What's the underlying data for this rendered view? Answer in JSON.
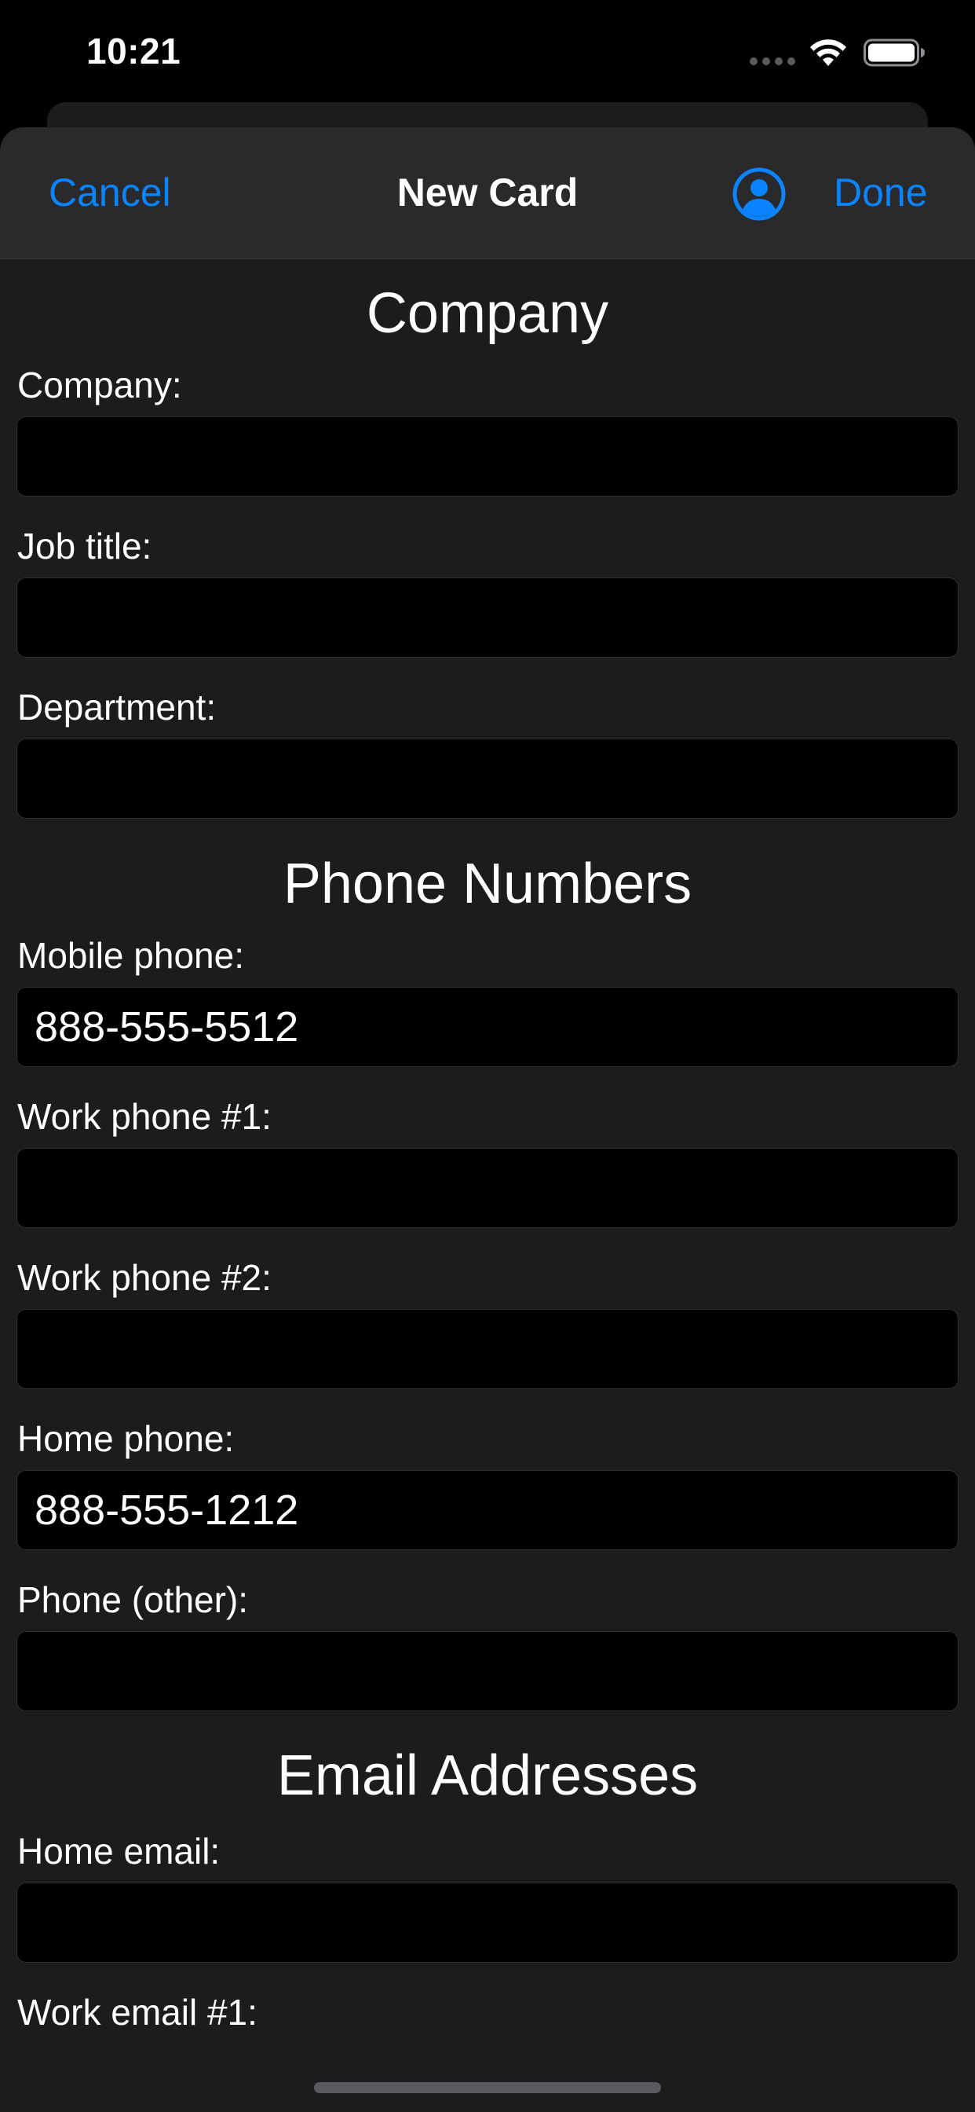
{
  "status_bar": {
    "time": "10:21"
  },
  "nav": {
    "cancel_label": "Cancel",
    "title": "New Card",
    "done_label": "Done",
    "person_icon": "person-circle-icon"
  },
  "colors": {
    "accent": "#0a84ff",
    "sheet_bg": "#1c1c1e",
    "nav_bg": "#2a2a2c",
    "input_bg": "#000000"
  },
  "sections": {
    "company": {
      "title": "Company",
      "fields": [
        {
          "label": "Company:",
          "value": ""
        },
        {
          "label": "Job title:",
          "value": ""
        },
        {
          "label": "Department:",
          "value": ""
        }
      ]
    },
    "phone": {
      "title": "Phone Numbers",
      "fields": [
        {
          "label": "Mobile phone:",
          "value": "888-555-5512"
        },
        {
          "label": "Work phone #1:",
          "value": ""
        },
        {
          "label": "Work phone #2:",
          "value": ""
        },
        {
          "label": "Home phone:",
          "value": "888-555-1212"
        },
        {
          "label": "Phone (other):",
          "value": ""
        }
      ]
    },
    "email": {
      "title": "Email Addresses",
      "fields": [
        {
          "label": "Home email:",
          "value": ""
        },
        {
          "label": "Work email #1:",
          "value": ""
        }
      ]
    }
  }
}
